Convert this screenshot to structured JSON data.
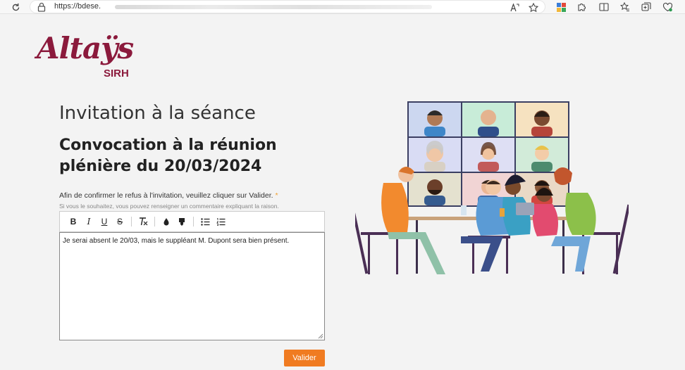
{
  "browser": {
    "url": "https://bdese."
  },
  "logo": {
    "script_text": "Altaÿs",
    "sub_text": "SIRH"
  },
  "page": {
    "title": "Invitation à la séance",
    "subtitle": "Convocation à la réunion plénière du 20/03/2024"
  },
  "form": {
    "label": "Afin de confirmer le refus à l'invitation, veuillez cliquer sur Valider.",
    "required_mark": "*",
    "hint": "Si vous le souhaitez, vous pouvez renseigner un commentaire expliquant la raison.",
    "toolbar": {
      "bold": "B",
      "italic": "I",
      "underline": "U",
      "strike": "S"
    },
    "comment": "Je serai absent le 20/03, mais le suppléant M. Dupont sera bien présent.",
    "submit_label": "Valider"
  },
  "colors": {
    "brand": "#8b1a3c",
    "button": "#f07b21"
  }
}
